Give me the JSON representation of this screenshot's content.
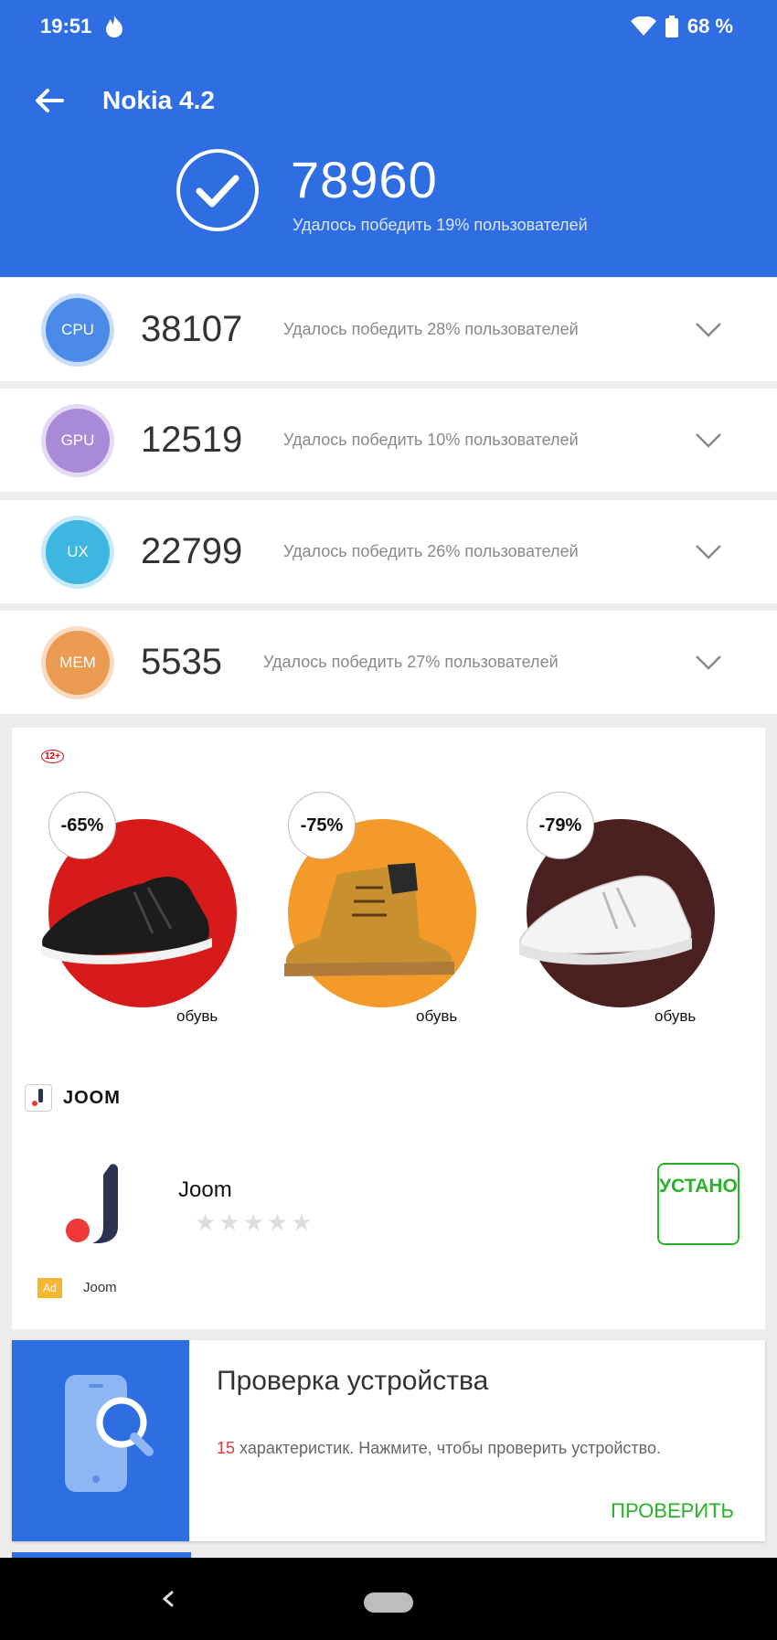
{
  "status_bar": {
    "time": "19:51",
    "battery": "68 %"
  },
  "header": {
    "title": "Nokia 4.2",
    "total_score": "78960",
    "total_subtitle": "Удалось победить 19% пользователей"
  },
  "scores": [
    {
      "badge": "CPU",
      "value": "38107",
      "desc": "Удалось победить 28% пользователей",
      "color": "#4a8ae8"
    },
    {
      "badge": "GPU",
      "value": "12519",
      "desc": "Удалось победить 10% пользователей",
      "color": "#a98ad8"
    },
    {
      "badge": "UX",
      "value": "22799",
      "desc": "Удалось победить 26% пользователей",
      "color": "#3db6e2"
    },
    {
      "badge": "MEM",
      "value": "5535",
      "desc": "Удалось победить 27% пользователей",
      "color": "#eb9a52"
    }
  ],
  "ad": {
    "age_rating": "12+",
    "products": [
      {
        "discount": "-65%",
        "label": "обувь",
        "bg": "#d71a1a"
      },
      {
        "discount": "-75%",
        "label": "обувь",
        "bg": "#f39a2a"
      },
      {
        "discount": "-79%",
        "label": "обувь",
        "bg": "#4a2020"
      }
    ],
    "brand": "JOOM",
    "app_name": "Joom",
    "stars": "★★★★★",
    "install_label": "УСТАНОВИТЬ",
    "ad_tag": "Ad",
    "advertiser": "Joom"
  },
  "device_check": {
    "title": "Проверка устройства",
    "count": "15",
    "desc": " характеристик. Нажмите, чтобы проверить устройство.",
    "button": "ПРОВЕРИТЬ"
  }
}
